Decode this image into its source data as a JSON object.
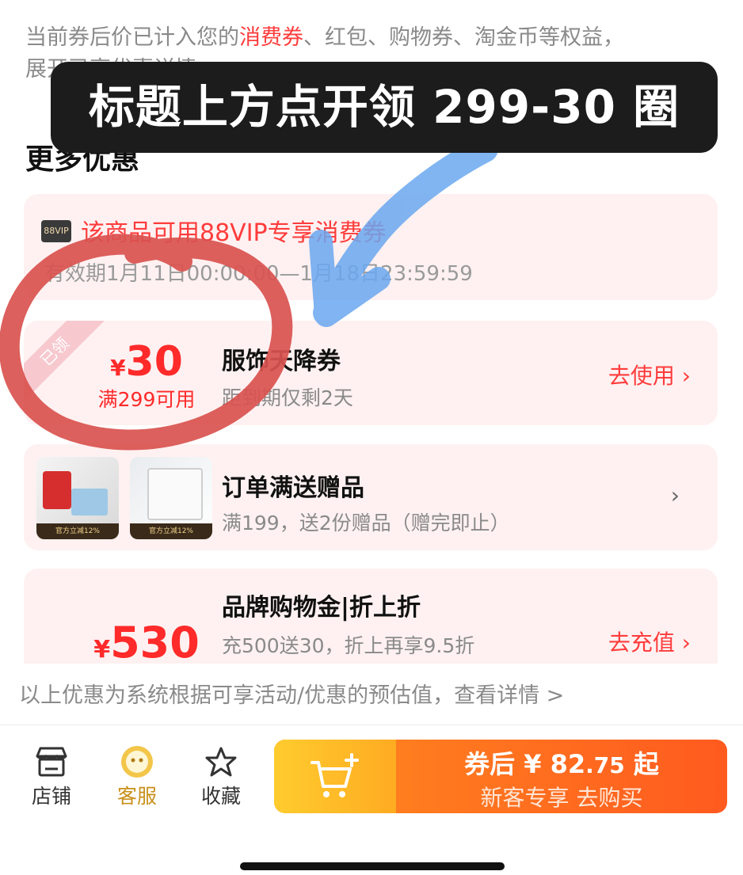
{
  "intro": {
    "text_before": "当前券后价已计入您的",
    "highlight": "消费券",
    "text_after": "、红包、购物券、淘金币等权益，",
    "line2_prefix": "展开",
    "toggle_label": "已享优惠详情"
  },
  "banner": "标题上方点开领 299-30 圈",
  "section_title": "更多优惠",
  "vip_card": {
    "badge": "88VIP",
    "text": "该商品可用88VIP专享消费券",
    "validity": "有效期1月11日00:00:00—1月18日23:59:59"
  },
  "coupon": {
    "ribbon": "已领",
    "currency": "¥",
    "amount": "30",
    "threshold": "满299可用",
    "title": "服饰天降券",
    "subtitle": "距到期仅剩2天",
    "action": "去使用"
  },
  "gift": {
    "title": "订单满送赠品",
    "subtitle": "满199，送2份赠品（赠完即止）",
    "thumb1_tag": "官方立减12%",
    "thumb2_tag": "官方立减12%"
  },
  "brand": {
    "currency": "¥",
    "amount": "530",
    "title": "品牌购物金|折上折",
    "subtitle": "充500送30，折上再享9.5折",
    "action": "去充值"
  },
  "footnote": "以上优惠为系统根据可享活动/优惠的预估值，查看详情 >",
  "bottom_bar": {
    "shop": "店铺",
    "service": "客服",
    "favorite": "收藏",
    "buy_line1_prefix": "券后 ¥ 82",
    "buy_line1_decimal": ".75",
    "buy_line1_suffix": " 起",
    "buy_line2": "新客专享  去购买"
  },
  "colors": {
    "accent_red": "#ff3c3c",
    "card_bg": "#fff1f1",
    "buy_orange": "#ff5a1f",
    "cart_yellow": "#ffcc2e",
    "annotation_red": "#d9534f",
    "annotation_blue": "#6aa8f0"
  }
}
